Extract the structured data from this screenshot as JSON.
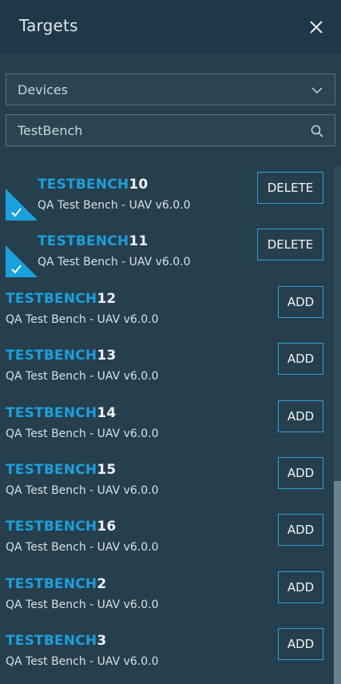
{
  "header": {
    "title": "Targets",
    "close_icon": "close-icon"
  },
  "filter": {
    "selected": "Devices",
    "icon": "chevron-down-icon"
  },
  "search": {
    "value": "TestBench",
    "icon": "search-icon"
  },
  "colors": {
    "accent": "#1aa0dc",
    "background": "#263f4d",
    "header": "#1e3847"
  },
  "targets": [
    {
      "prefix": "TESTBENCH",
      "number": "10",
      "subtitle": "QA Test Bench - UAV v6.0.0",
      "selected": true,
      "action": "DELETE"
    },
    {
      "prefix": "TESTBENCH",
      "number": "11",
      "subtitle": "QA Test Bench - UAV v6.0.0",
      "selected": true,
      "action": "DELETE"
    },
    {
      "prefix": "TESTBENCH",
      "number": "12",
      "subtitle": "QA Test Bench - UAV v6.0.0",
      "selected": false,
      "action": "ADD"
    },
    {
      "prefix": "TESTBENCH",
      "number": "13",
      "subtitle": "QA Test Bench - UAV v6.0.0",
      "selected": false,
      "action": "ADD"
    },
    {
      "prefix": "TESTBENCH",
      "number": "14",
      "subtitle": "QA Test Bench - UAV v6.0.0",
      "selected": false,
      "action": "ADD"
    },
    {
      "prefix": "TESTBENCH",
      "number": "15",
      "subtitle": "QA Test Bench - UAV v6.0.0",
      "selected": false,
      "action": "ADD"
    },
    {
      "prefix": "TESTBENCH",
      "number": "16",
      "subtitle": "QA Test Bench - UAV v6.0.0",
      "selected": false,
      "action": "ADD"
    },
    {
      "prefix": "TESTBENCH",
      "number": "2",
      "subtitle": "QA Test Bench - UAV v6.0.0",
      "selected": false,
      "action": "ADD"
    },
    {
      "prefix": "TESTBENCH",
      "number": "3",
      "subtitle": "QA Test Bench - UAV v6.0.0",
      "selected": false,
      "action": "ADD"
    }
  ]
}
